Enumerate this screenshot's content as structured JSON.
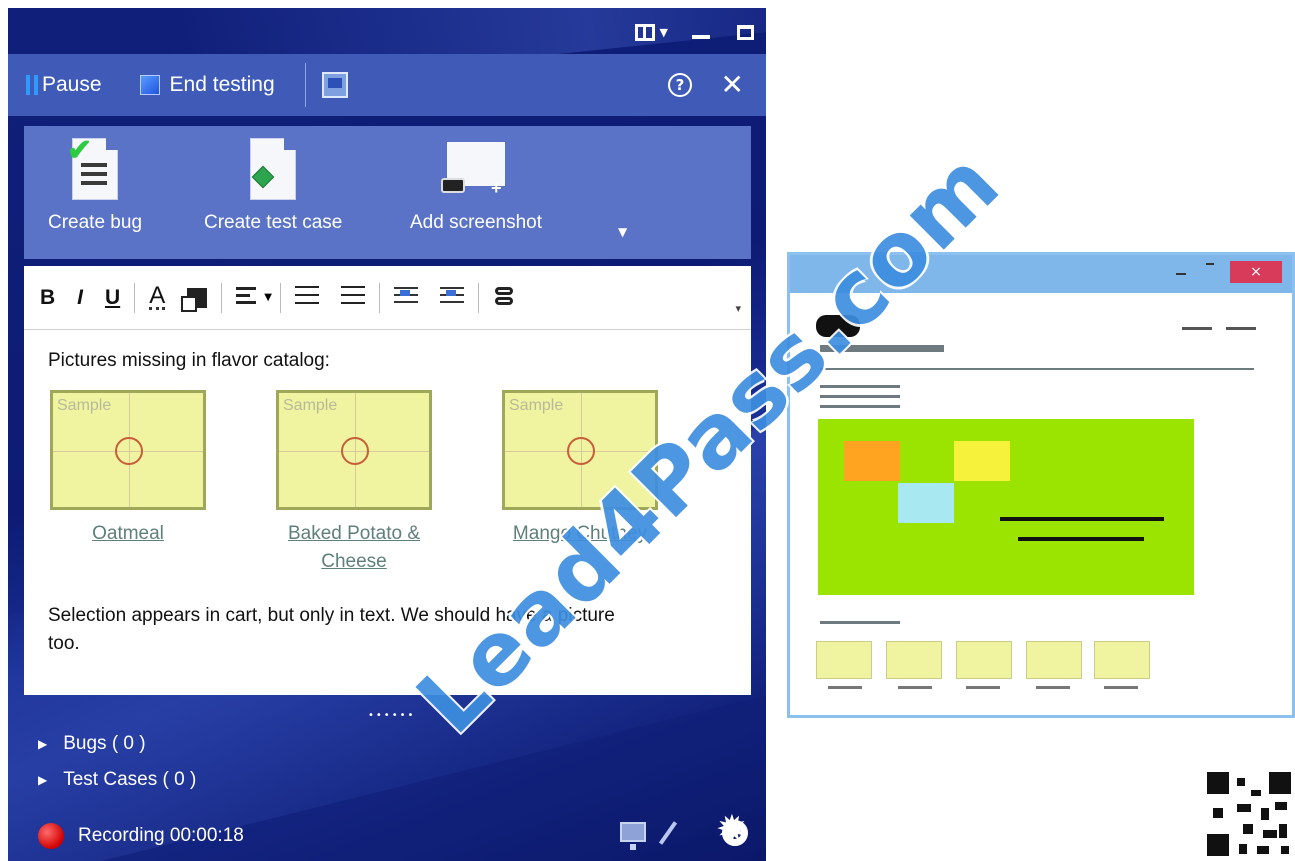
{
  "toolbar": {
    "pause_label": "Pause",
    "end_testing_label": "End testing",
    "help_glyph": "?",
    "close_glyph": "✕"
  },
  "actions": {
    "create_bug": "Create bug",
    "create_test_case": "Create test case",
    "add_screenshot": "Add screenshot"
  },
  "format_bar": {
    "bold": "B",
    "italic": "I",
    "underline": "U",
    "font_color": "A"
  },
  "editor": {
    "heading": "Pictures missing in flavor catalog:",
    "thumbnails": [
      {
        "sample_text": "Sample",
        "caption": "Oatmeal"
      },
      {
        "sample_text": "Sample",
        "caption": "Baked Potato & Cheese"
      },
      {
        "sample_text": "Sample",
        "caption": "Mango Chutney"
      }
    ],
    "note": "Selection appears in cart, but only in text. We should have a picture too."
  },
  "tree": {
    "bugs_label": "Bugs ( 0 )",
    "test_cases_label": "Test Cases ( 0 )"
  },
  "status": {
    "recording_label": "Recording 00:00:18"
  },
  "watermark": "Lead4Pass.com",
  "colors": {
    "runner_bg": "#10207a",
    "toolbar_bg": "#3f5bb7",
    "action_bar_bg": "#5a73c6",
    "hero_green": "#9be300",
    "thumb_yellow": "#f0f4a0",
    "record_red": "#d10000",
    "watermark_blue": "#3d8ee0"
  }
}
